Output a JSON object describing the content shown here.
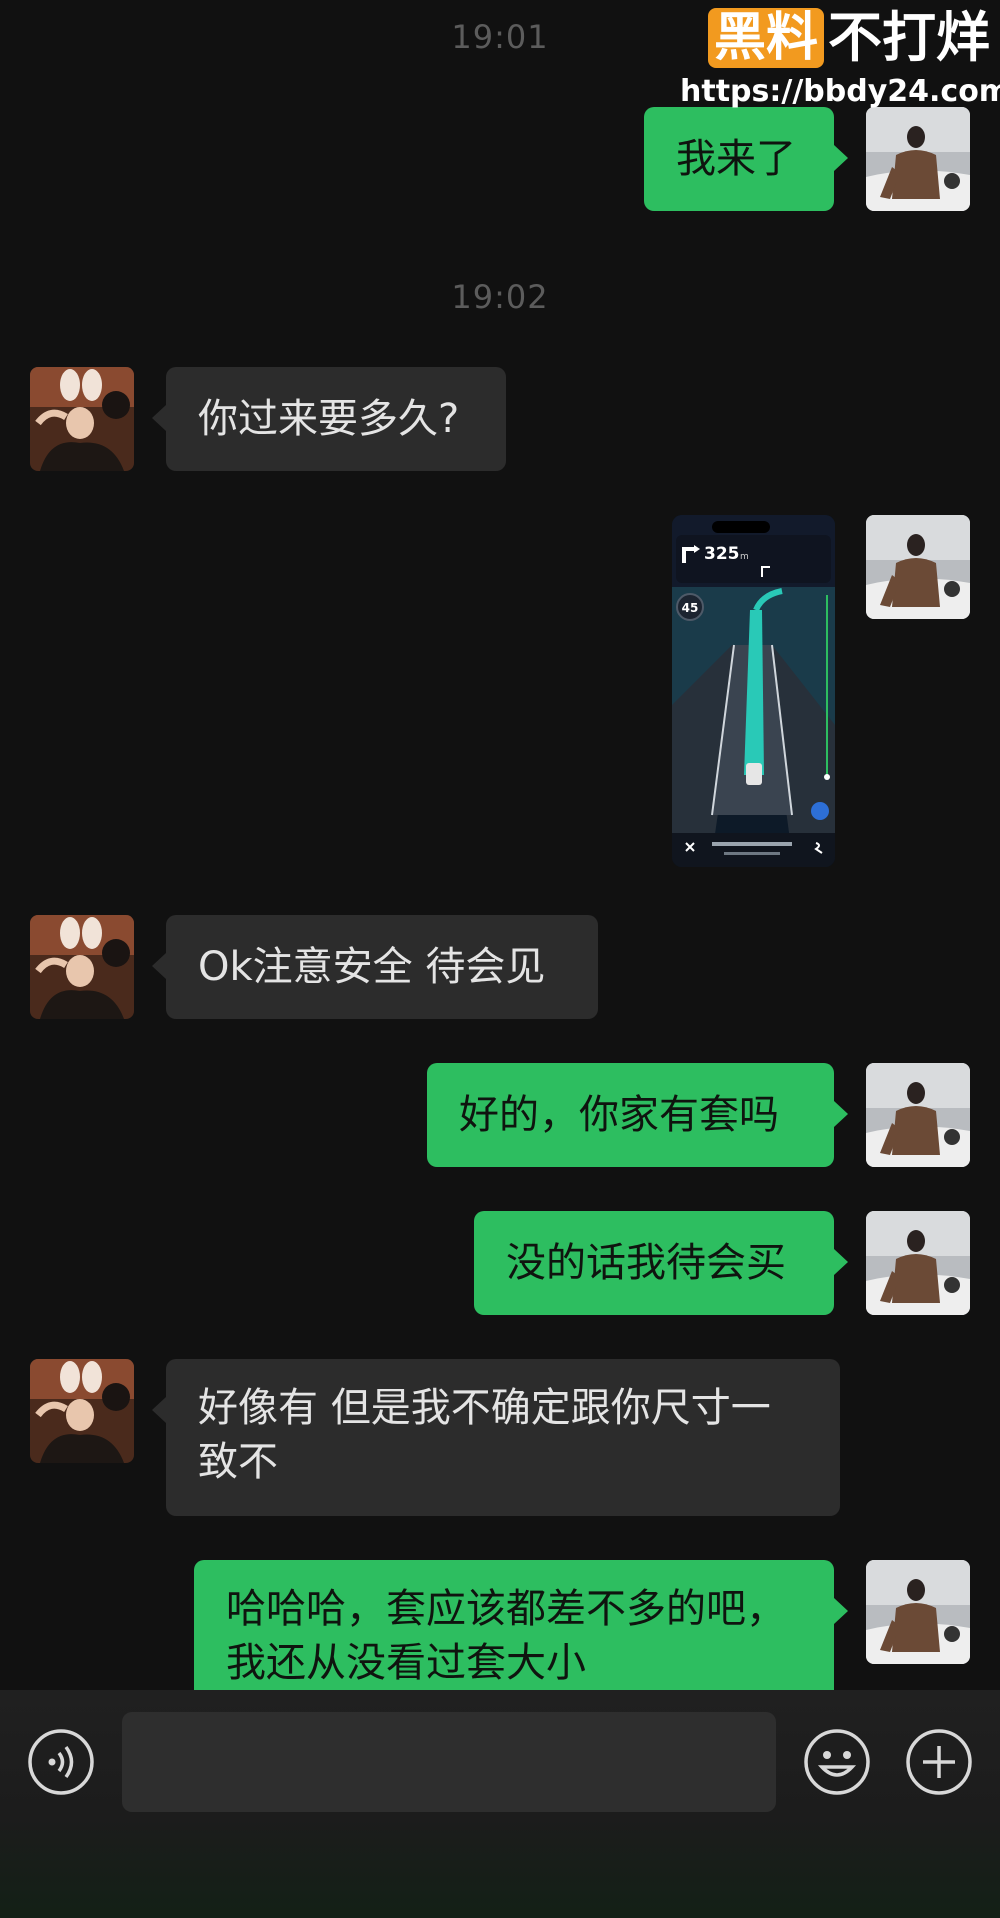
{
  "watermark": {
    "brand_highlight": "黑料",
    "brand_rest": "不打烊",
    "url": "https://bbdy24.com"
  },
  "messages": [
    {
      "type": "time",
      "text": "19:01"
    },
    {
      "type": "out",
      "text": "我来了"
    },
    {
      "type": "time",
      "text": "19:02"
    },
    {
      "type": "in",
      "text": "你过来要多久?"
    },
    {
      "type": "out-image",
      "description_icon": "navigation-screenshot",
      "nav": {
        "distance": "325",
        "distance_unit": "m",
        "speed": "45"
      }
    },
    {
      "type": "in",
      "text": "Ok注意安全 待会见"
    },
    {
      "type": "out",
      "text": "好的，你家有套吗"
    },
    {
      "type": "out",
      "text": "没的话我待会买"
    },
    {
      "type": "in",
      "text": "好像有 但是我不确定跟你尺寸一\n致不"
    },
    {
      "type": "out",
      "text": "哈哈哈，套应该都差不多的吧，\n我还从没看过套大小"
    }
  ],
  "input_bar": {
    "voice_icon": "voice-icon",
    "emoji_icon": "emoji-icon",
    "plus_icon": "plus-icon"
  },
  "colors": {
    "background": "#111111",
    "incoming_bubble": "#2c2c2c",
    "outgoing_bubble": "#2dbe60",
    "timestamp": "#5c5c5c",
    "watermark_accent": "#f29a1f"
  }
}
